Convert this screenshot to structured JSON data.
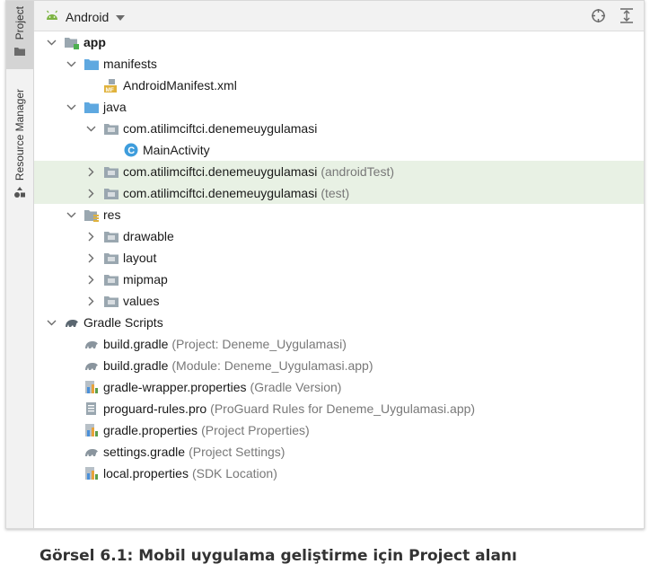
{
  "sidebar": {
    "project_label": "Project",
    "resource_label": "Resource Manager"
  },
  "toolbar": {
    "title": "Android"
  },
  "tree": [
    {
      "name": "app",
      "hint": "",
      "indent": 0,
      "arrow": "down",
      "icon": "module-folder-icon",
      "bold": true,
      "highlight": false
    },
    {
      "name": "manifests",
      "hint": "",
      "indent": 1,
      "arrow": "down",
      "icon": "folder-blue-icon",
      "bold": false,
      "highlight": false
    },
    {
      "name": "AndroidManifest.xml",
      "hint": "",
      "indent": 2,
      "arrow": "none",
      "icon": "manifest-file-icon",
      "bold": false,
      "highlight": false
    },
    {
      "name": "java",
      "hint": "",
      "indent": 1,
      "arrow": "down",
      "icon": "folder-blue-icon",
      "bold": false,
      "highlight": false
    },
    {
      "name": "com.atilimciftci.denemeuygulamasi",
      "hint": "",
      "indent": 2,
      "arrow": "down",
      "icon": "package-icon",
      "bold": false,
      "highlight": false
    },
    {
      "name": "MainActivity",
      "hint": "",
      "indent": 3,
      "arrow": "none",
      "icon": "class-icon",
      "bold": false,
      "highlight": false
    },
    {
      "name": "com.atilimciftci.denemeuygulamasi",
      "hint": "(androidTest)",
      "indent": 2,
      "arrow": "right",
      "icon": "package-icon",
      "bold": false,
      "highlight": true
    },
    {
      "name": "com.atilimciftci.denemeuygulamasi",
      "hint": "(test)",
      "indent": 2,
      "arrow": "right",
      "icon": "package-icon",
      "bold": false,
      "highlight": true
    },
    {
      "name": "res",
      "hint": "",
      "indent": 1,
      "arrow": "down",
      "icon": "res-folder-icon",
      "bold": false,
      "highlight": false
    },
    {
      "name": "drawable",
      "hint": "",
      "indent": 2,
      "arrow": "right",
      "icon": "package-icon",
      "bold": false,
      "highlight": false
    },
    {
      "name": "layout",
      "hint": "",
      "indent": 2,
      "arrow": "right",
      "icon": "package-icon",
      "bold": false,
      "highlight": false
    },
    {
      "name": "mipmap",
      "hint": "",
      "indent": 2,
      "arrow": "right",
      "icon": "package-icon",
      "bold": false,
      "highlight": false
    },
    {
      "name": "values",
      "hint": "",
      "indent": 2,
      "arrow": "right",
      "icon": "package-icon",
      "bold": false,
      "highlight": false
    },
    {
      "name": "Gradle Scripts",
      "hint": "",
      "indent": 0,
      "arrow": "down",
      "icon": "gradle-icon",
      "bold": false,
      "highlight": false
    },
    {
      "name": "build.gradle",
      "hint": "(Project: Deneme_Uygulamasi)",
      "indent": 1,
      "arrow": "none",
      "icon": "gradle-file-icon",
      "bold": false,
      "highlight": false
    },
    {
      "name": "build.gradle",
      "hint": "(Module: Deneme_Uygulamasi.app)",
      "indent": 1,
      "arrow": "none",
      "icon": "gradle-file-icon",
      "bold": false,
      "highlight": false
    },
    {
      "name": "gradle-wrapper.properties",
      "hint": "(Gradle Version)",
      "indent": 1,
      "arrow": "none",
      "icon": "properties-file-icon",
      "bold": false,
      "highlight": false
    },
    {
      "name": "proguard-rules.pro",
      "hint": "(ProGuard Rules for Deneme_Uygulamasi.app)",
      "indent": 1,
      "arrow": "none",
      "icon": "text-file-icon",
      "bold": false,
      "highlight": false
    },
    {
      "name": "gradle.properties",
      "hint": "(Project Properties)",
      "indent": 1,
      "arrow": "none",
      "icon": "properties-file-icon",
      "bold": false,
      "highlight": false
    },
    {
      "name": "settings.gradle",
      "hint": "(Project Settings)",
      "indent": 1,
      "arrow": "none",
      "icon": "gradle-file-icon",
      "bold": false,
      "highlight": false
    },
    {
      "name": "local.properties",
      "hint": "(SDK Location)",
      "indent": 1,
      "arrow": "none",
      "icon": "properties-file-icon",
      "bold": false,
      "highlight": false
    }
  ],
  "caption": "Görsel 6.1: Mobil uygulama geliştirme için Project alanı"
}
